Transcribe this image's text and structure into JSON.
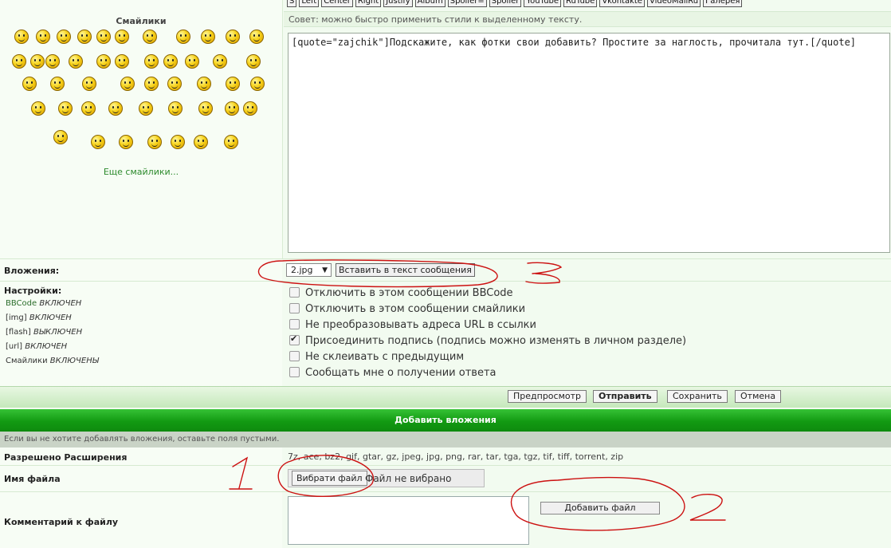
{
  "smileys": {
    "title": "Смайлики",
    "more_link": "Еще смайлики...",
    "count": 51
  },
  "toolbar": {
    "buttons": [
      "S",
      "Left",
      "Center",
      "Right",
      "Justify",
      "Album",
      "Spoiler=",
      "Spoiler",
      "YouTube",
      "RuTube",
      "Vkontakte",
      "VideoMailRu",
      "Галерея"
    ]
  },
  "editor": {
    "hint": "Совет: можно быстро применить стили к выделенному тексту.",
    "message": "[quote=\"zajchik\"]Подскажите, как фотки свои добавить? Простите за наглость, прочитала тут.[/quote]"
  },
  "attachments": {
    "label": "Вложения:",
    "selected_file": "2.jpg",
    "insert_button": "Вставить в текст сообщения"
  },
  "settings": {
    "label": "Настройки:",
    "status": [
      {
        "name": "BBCode",
        "state": "ВКЛЮЧЕН"
      },
      {
        "name": "[img]",
        "state": "ВКЛЮЧЕН"
      },
      {
        "name": "[flash]",
        "state": "ВЫКЛЮЧЕН"
      },
      {
        "name": "[url]",
        "state": "ВКЛЮЧЕН"
      },
      {
        "name": "Смайлики",
        "state": "ВКЛЮЧЕНЫ"
      }
    ],
    "options": [
      {
        "label": "Отключить в этом сообщении BBCode",
        "checked": false
      },
      {
        "label": "Отключить в этом сообщении смайлики",
        "checked": false
      },
      {
        "label": "Не преобразовывать адреса URL в ссылки",
        "checked": false
      },
      {
        "label": "Присоединить подпись (подпись можно изменять в личном разделе)",
        "checked": true
      },
      {
        "label": "Не склеивать с предыдущим",
        "checked": false
      },
      {
        "label": "Сообщать мне о получении ответа",
        "checked": false
      }
    ]
  },
  "actions": {
    "preview": "Предпросмотр",
    "submit": "Отправить",
    "save": "Сохранить",
    "cancel": "Отмена"
  },
  "add_attachments": {
    "header": "Добавить вложения",
    "notice": "Если вы не хотите добавлять вложения, оставьте поля пустыми.",
    "extensions_label": "Разрешено Расширения",
    "extensions": "7z, ace, bz2, gif, gtar, gz, jpeg, jpg, png, rar, tar, tga, tgz, tif, tiff, torrent, zip",
    "filename_label": "Имя файла",
    "choose_button": "Вибрати файл",
    "no_file": "Файл не вибрано",
    "comment_label": "Комментарий к файлу",
    "add_button": "Добавить файл"
  },
  "annotations": {
    "one": "1",
    "two": "2",
    "three": "3"
  },
  "colors": {
    "page_bg": "#f2fbf0",
    "header_green": "#129a12",
    "annotation_red": "#cc1111",
    "link_green": "#2c8a2c"
  }
}
